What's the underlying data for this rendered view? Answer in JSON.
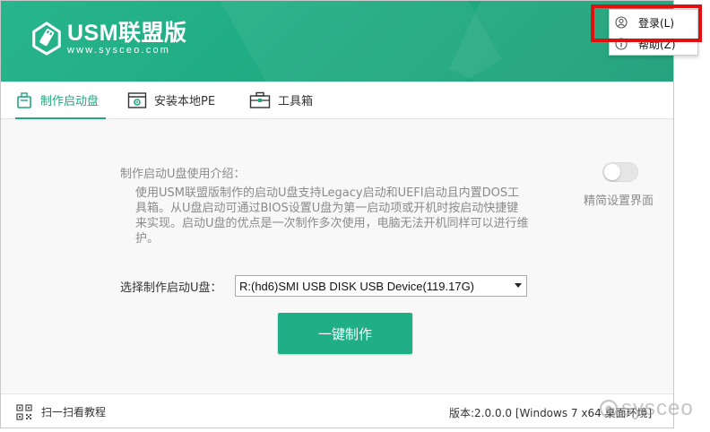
{
  "header": {
    "app_title": "USM联盟版",
    "url": "www.sysceo.com"
  },
  "tabs": [
    {
      "label": "制作启动盘",
      "icon": "usb-drive-icon",
      "active": true
    },
    {
      "label": "安装本地PE",
      "icon": "gear-window-icon",
      "active": false
    },
    {
      "label": "工具箱",
      "icon": "toolbox-icon",
      "active": false
    }
  ],
  "intro": {
    "title": "制作启动U盘使用介绍：",
    "body": "使用USM联盟版制作的启动U盘支持Legacy启动和UEFI启动且内置DOS工具箱。从U盘启动可通过BIOS设置U盘为第一启动项或开机时按启动快捷键来实现。启动U盘的优点是一次制作多次使用，电脑无法开机同样可以进行维护。"
  },
  "toggle": {
    "label": "精简设置界面",
    "on": false
  },
  "select": {
    "label": "选择制作启动U盘：",
    "value": "R:(hd6)SMI USB DISK USB Device(119.17G)"
  },
  "make_button": {
    "label": "一键制作"
  },
  "footer": {
    "scan_label": "扫一扫看教程",
    "version": "版本:2.0.0.0 [Windows 7 x64 桌面环境]"
  },
  "popup_menu": {
    "items": [
      {
        "label": "登录(L)",
        "icon": "user-circle-icon"
      },
      {
        "label": "帮助(Z)",
        "icon": "info-circle-icon"
      }
    ]
  },
  "watermark": {
    "text": "sysceo"
  },
  "colors": {
    "brand_green": "#1fa97f",
    "highlight_red": "#e01010"
  }
}
